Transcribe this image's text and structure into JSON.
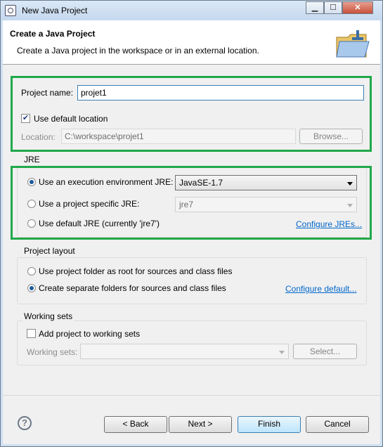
{
  "window": {
    "title": "New Java Project",
    "minimize": "▁",
    "maximize": "☐",
    "close": "✕"
  },
  "header": {
    "title": "Create a Java Project",
    "subtitle": "Create a Java project in the workspace or in an external location."
  },
  "project": {
    "name_label": "Project name:",
    "name_value": "projet1",
    "default_location_label": "Use default location",
    "default_location_checked": true,
    "location_label": "Location:",
    "location_value": "C:\\workspace\\projet1",
    "browse_label": "Browse..."
  },
  "jre": {
    "group_label": "JRE",
    "options": [
      {
        "label": "Use an execution environment JRE:",
        "selected": true
      },
      {
        "label": "Use a project specific JRE:",
        "selected": false
      },
      {
        "label": "Use default JRE (currently 'jre7')",
        "selected": false
      }
    ],
    "env_value": "JavaSE-1.7",
    "specific_value": "jre7",
    "configure_link": "Configure JREs..."
  },
  "layout": {
    "group_label": "Project layout",
    "options": [
      {
        "label": "Use project folder as root for sources and class files",
        "selected": false
      },
      {
        "label": "Create separate folders for sources and class files",
        "selected": true
      }
    ],
    "configure_link": "Configure default..."
  },
  "working_sets": {
    "group_label": "Working sets",
    "add_label": "Add project to working sets",
    "add_checked": false,
    "sets_label": "Working sets:",
    "select_label": "Select..."
  },
  "footer": {
    "help_symbol": "?",
    "back_label": "< Back",
    "next_label": "Next >",
    "finish_label": "Finish",
    "cancel_label": "Cancel"
  },
  "colors": {
    "highlight": "#21a84a",
    "link": "#0066cc"
  }
}
